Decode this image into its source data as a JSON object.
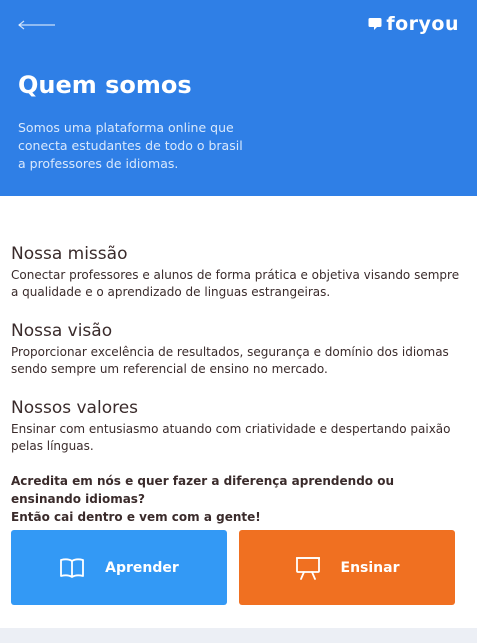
{
  "header": {
    "logo_text": "foryou",
    "title": "Quem somos",
    "description": "Somos uma plataforma online que conecta estudantes de todo o brasil a professores de idiomas."
  },
  "sections": [
    {
      "title": "Nossa missão",
      "text": "Conectar professores e alunos de forma prática e objetiva visando sempre a qualidade e o aprendizado de linguas estrangeiras."
    },
    {
      "title": "Nossa visão",
      "text": "Proporcionar excelência de resultados, segurança e domínio dos idiomas sendo sempre um referencial de ensino no mercado."
    },
    {
      "title": "Nossos valores",
      "text": "Ensinar com entusiasmo atuando com criatividade e despertando paixão pelas línguas."
    }
  ],
  "cta": {
    "line1": "Acredita em nós e quer fazer a diferença aprendendo ou ensinando idiomas?",
    "line2": "Então cai dentro e vem com a gente!"
  },
  "buttons": {
    "learn_label": "Aprender",
    "learn_icon": "book-icon",
    "teach_label": "Ensinar",
    "teach_icon": "presentation-board-icon"
  },
  "colors": {
    "hero": "#2f7fe6",
    "learn": "#3399f5",
    "teach": "#f07021"
  }
}
